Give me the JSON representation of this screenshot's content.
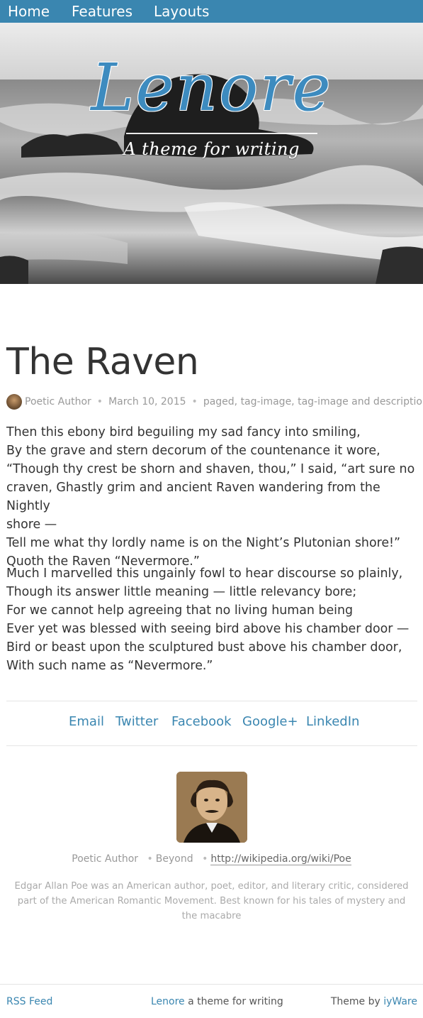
{
  "nav": {
    "items": [
      {
        "label": "Home"
      },
      {
        "label": "Features"
      },
      {
        "label": "Layouts"
      }
    ]
  },
  "hero": {
    "title": "Lenore",
    "subtitle": "A theme for writing"
  },
  "post": {
    "title": "The Raven",
    "author": "Poetic Author",
    "date": "March 10, 2015",
    "tags": "paged, tag-image, tag-image and description",
    "stanza1": [
      "Then this ebony bird beguiling my sad fancy into smiling,",
      "By the grave and stern decorum of the countenance it wore,",
      "“Though thy crest be shorn and shaven, thou,” I said, “art sure no",
      "craven, Ghastly grim and ancient Raven wandering from the Nightly",
      "shore —",
      "Tell me what thy lordly name is on the Night’s Plutonian shore!”",
      "Quoth the Raven “Nevermore.”"
    ],
    "stanza2": [
      "Much I marvelled this ungainly fowl to hear discourse so plainly,",
      "Though its answer little meaning — little relevancy bore;",
      "For we cannot help agreeing that no living human being",
      "Ever yet was blessed with seeing bird above his chamber door —",
      "Bird or beast upon the sculptured bust above his chamber door,",
      "With such name as “Nevermore.”"
    ]
  },
  "share": {
    "links": [
      {
        "label": "Email"
      },
      {
        "label": "Twitter"
      },
      {
        "label": "Facebook"
      },
      {
        "label": "Google+"
      },
      {
        "label": "LinkedIn"
      }
    ]
  },
  "author_box": {
    "name": "Poetic Author",
    "location": "Beyond",
    "website": "http://wikipedia.org/wiki/Poe",
    "bio": "Edgar Allan Poe was an American author, poet, editor, and literary critic, considered part of the American Romantic Movement. Best known for his tales of mystery and the macabre"
  },
  "footer": {
    "rss": "RSS Feed",
    "theme_name": "Lenore",
    "theme_tagline": " a theme for writing",
    "credit_prefix": "Theme by ",
    "credit_link": "iyWare"
  },
  "colors": {
    "accent": "#3a86b0",
    "nav_bg": "#3a86b0",
    "text": "#333333",
    "muted": "#999999"
  }
}
